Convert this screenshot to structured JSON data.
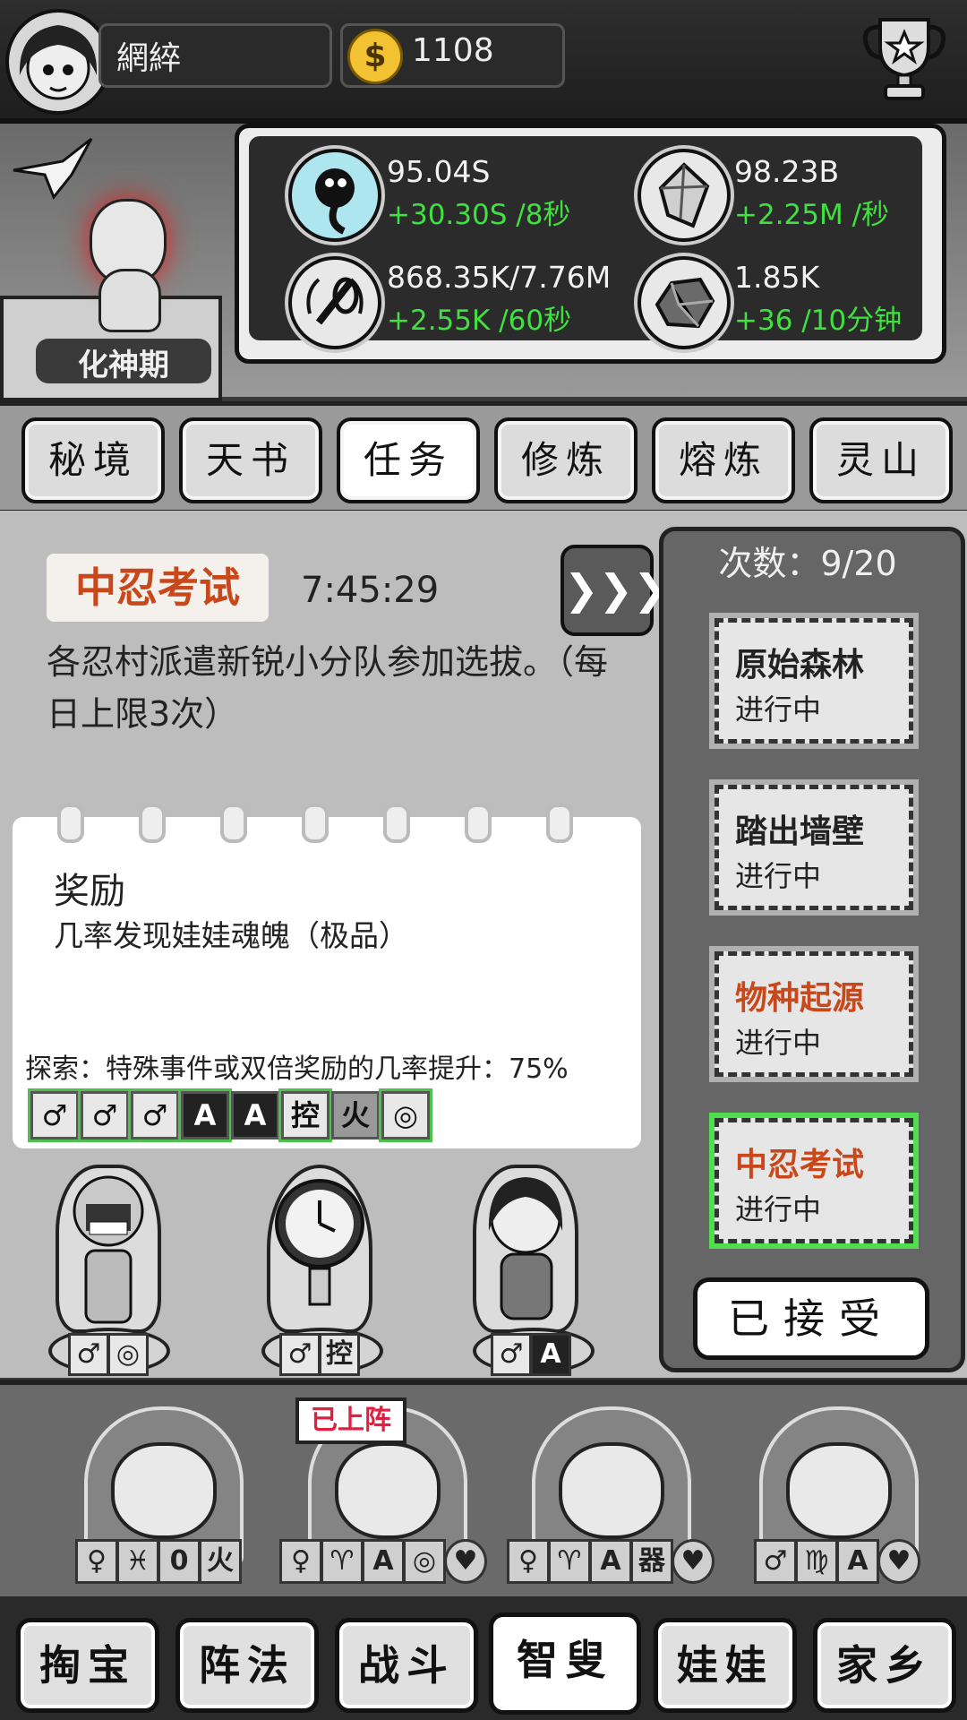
{
  "top_bar": {
    "player_name": "網綷",
    "coins": "1108",
    "coin_symbol": "$"
  },
  "header": {
    "stage": "化神期",
    "resources": [
      {
        "icon": "tadpole-icon",
        "value": "95.04S",
        "rate": "+30.30S /8秒"
      },
      {
        "icon": "crystal-icon",
        "value": "98.23B",
        "rate": "+2.25M /秒"
      },
      {
        "icon": "sword-wreath-icon",
        "value": "868.35K/7.76M",
        "rate": "+2.55K /60秒"
      },
      {
        "icon": "ore-icon",
        "value": "1.85K",
        "rate": "+36 /10分钟"
      }
    ]
  },
  "tabs": [
    "秘境",
    "天书",
    "任务",
    "修炼",
    "熔炼",
    "灵山"
  ],
  "active_tab": "任务",
  "task": {
    "tag": "中忍考试",
    "timer": "7:45:29",
    "skip_label": "❯❯❯",
    "description": "各忍村派遣新锐小分队参加选拔。（每日上限3次）",
    "reward_title": "奖励",
    "reward_text": "几率发现娃娃魂魄（极品）",
    "explore_text": "探索：特殊事件或双倍奖励的几率提升：75%",
    "attribute_tags": [
      "♂",
      "♂",
      "♂",
      "A",
      "A",
      "控",
      "火",
      "◎"
    ]
  },
  "characters": [
    {
      "icon": "titan-icon",
      "tags": [
        "♂",
        "◎"
      ]
    },
    {
      "icon": "clock-robot-icon",
      "tags": [
        "♂",
        "控"
      ]
    },
    {
      "icon": "girl-avatar-icon",
      "tags": [
        "♂",
        "A"
      ]
    }
  ],
  "quests": {
    "count_label": "次数：9/20",
    "items": [
      {
        "title": "原始森林",
        "status": "进行中",
        "highlight": false,
        "active": false
      },
      {
        "title": "踏出墙壁",
        "status": "进行中",
        "highlight": false,
        "active": false
      },
      {
        "title": "物种起源",
        "status": "进行中",
        "highlight": true,
        "active": false
      },
      {
        "title": "中忍考试",
        "status": "进行中",
        "highlight": true,
        "active": true
      }
    ],
    "accept_label": "已接受"
  },
  "team": {
    "deployed_label": "已上阵",
    "slots": [
      {
        "tags": [
          "♀",
          "♓",
          "0",
          "火"
        ]
      },
      {
        "tags": [
          "♀",
          "♈",
          "A",
          "◎",
          "♥"
        ]
      },
      {
        "tags": [
          "♀",
          "♈",
          "A",
          "器",
          "♥"
        ]
      },
      {
        "tags": [
          "♂",
          "♍",
          "A",
          "♥"
        ]
      }
    ]
  },
  "nav": [
    "掏宝",
    "阵法",
    "战斗",
    "智叟",
    "娃娃",
    "家乡"
  ],
  "active_nav": "智叟",
  "colors": {
    "accent_red": "#c8481c",
    "green_glow": "#4ede4e",
    "rate_green": "#3fe03f",
    "coin_gold": "#f2c232"
  }
}
